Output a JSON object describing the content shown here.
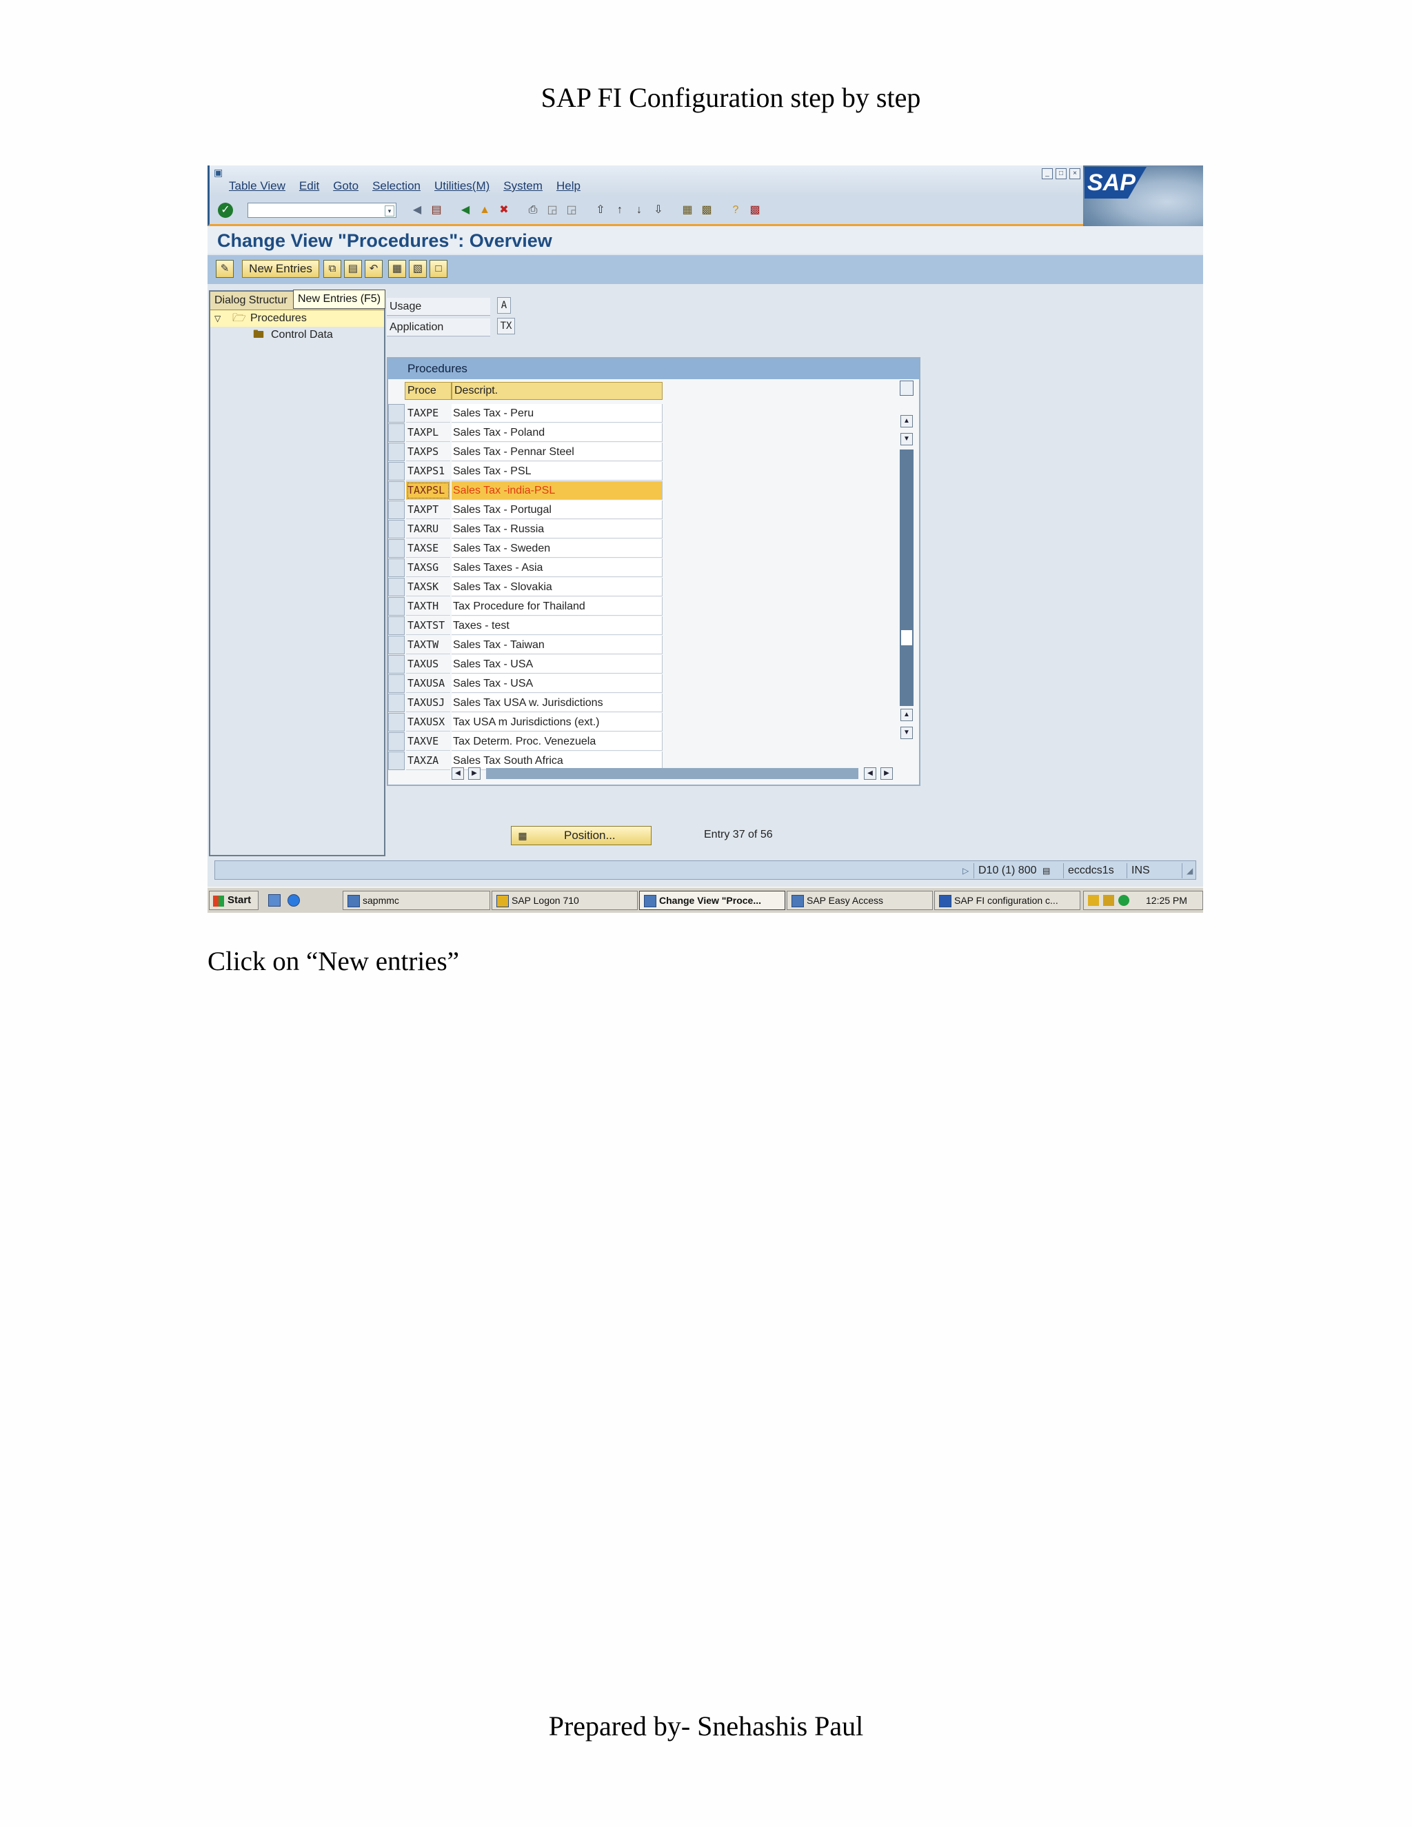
{
  "doc": {
    "title": "SAP FI Configuration step by step",
    "caption": "Click on “New entries”",
    "footer": "Prepared by- Snehashis Paul"
  },
  "sap": {
    "menu": [
      "Table View",
      "Edit",
      "Goto",
      "Selection",
      "Utilities(M)",
      "System",
      "Help"
    ],
    "logo": "SAP",
    "screen_title": "Change View \"Procedures\": Overview",
    "new_entries_label": "New Entries",
    "tooltip": "New Entries   (F5)",
    "dialog": {
      "header": "Dialog Structur",
      "items": [
        "Procedures",
        "Control Data"
      ]
    },
    "usage_label": "Usage",
    "usage_value": "A",
    "application_label": "Application",
    "application_value": "TX",
    "table_title": "Procedures",
    "columns": [
      "Proce",
      "Descript."
    ],
    "rows": [
      {
        "code": "TAXPE",
        "desc": "Sales Tax - Peru"
      },
      {
        "code": "TAXPL",
        "desc": "Sales Tax - Poland"
      },
      {
        "code": "TAXPS",
        "desc": "Sales Tax - Pennar Steel"
      },
      {
        "code": "TAXPS1",
        "desc": "Sales Tax - PSL"
      },
      {
        "code": "TAXPSL",
        "desc": "Sales Tax -india-PSL"
      },
      {
        "code": "TAXPT",
        "desc": "Sales Tax - Portugal"
      },
      {
        "code": "TAXRU",
        "desc": "Sales Tax - Russia"
      },
      {
        "code": "TAXSE",
        "desc": "Sales Tax - Sweden"
      },
      {
        "code": "TAXSG",
        "desc": "Sales Taxes - Asia"
      },
      {
        "code": "TAXSK",
        "desc": "Sales Tax - Slovakia"
      },
      {
        "code": "TAXTH",
        "desc": "Tax Procedure for Thailand"
      },
      {
        "code": "TAXTST",
        "desc": "Taxes - test"
      },
      {
        "code": "TAXTW",
        "desc": "Sales Tax - Taiwan"
      },
      {
        "code": "TAXUS",
        "desc": "Sales Tax - USA"
      },
      {
        "code": "TAXUSA",
        "desc": "Sales Tax - USA"
      },
      {
        "code": "TAXUSJ",
        "desc": "Sales Tax USA w. Jurisdictions"
      },
      {
        "code": "TAXUSX",
        "desc": "Tax USA m Jurisdictions (ext.)"
      },
      {
        "code": "TAXVE",
        "desc": "Tax Determ. Proc. Venezuela"
      },
      {
        "code": "TAXZA",
        "desc": "Sales Tax South Africa"
      }
    ],
    "highlighted_row": 4,
    "position_label": "Position...",
    "entry_info": "Entry 37 of 56",
    "status": {
      "system": "D10 (1) 800",
      "server": "eccdcs1s",
      "mode": "INS"
    }
  },
  "taskbar": {
    "start": "Start",
    "items": [
      "sapmmc",
      "SAP Logon 710",
      "Change View \"Proce...",
      "SAP Easy Access",
      "SAP FI configuration c..."
    ],
    "active_index": 2,
    "clock": "12:25 PM"
  }
}
